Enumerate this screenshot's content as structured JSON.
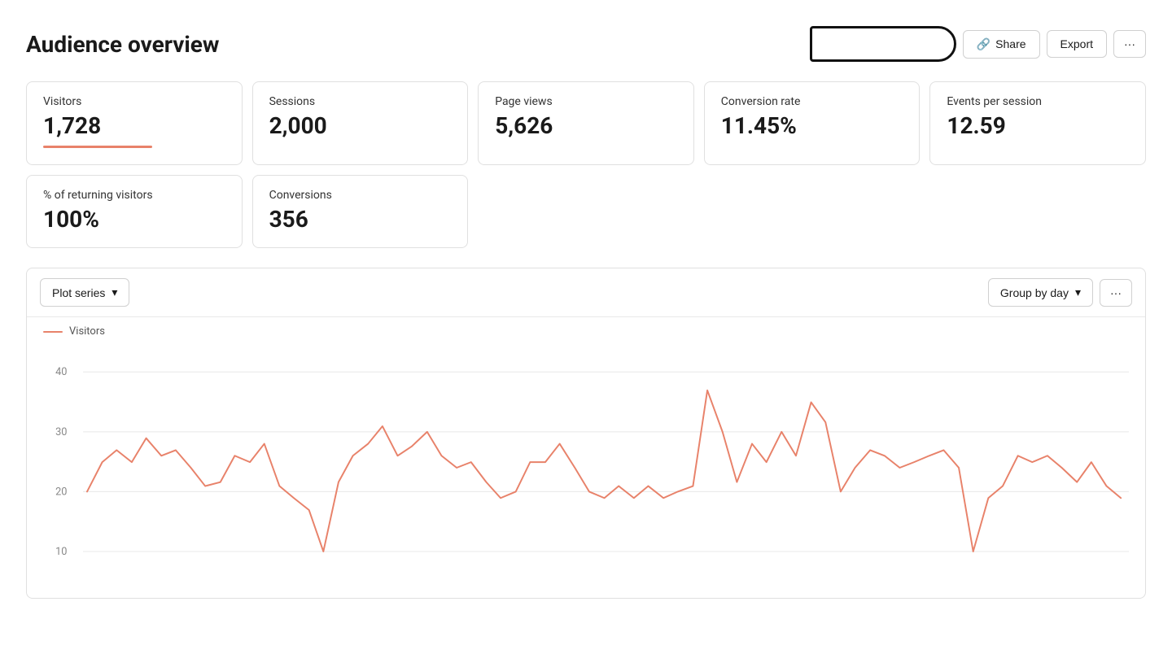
{
  "page": {
    "title": "Audience overview"
  },
  "header": {
    "share_label": "Share",
    "export_label": "Export",
    "more_label": "···"
  },
  "metrics_row1": [
    {
      "label": "Visitors",
      "value": "1,728",
      "underline": true
    },
    {
      "label": "Sessions",
      "value": "2,000",
      "underline": false
    },
    {
      "label": "Page views",
      "value": "5,626",
      "underline": false
    },
    {
      "label": "Conversion rate",
      "value": "11.45%",
      "underline": false
    },
    {
      "label": "Events per session",
      "value": "12.59",
      "underline": false
    }
  ],
  "metrics_row2": [
    {
      "label": "% of returning visitors",
      "value": "100%",
      "underline": false
    },
    {
      "label": "Conversions",
      "value": "356",
      "underline": false
    }
  ],
  "chart": {
    "plot_series_label": "Plot series",
    "group_by_label": "Group by day",
    "legend_label": "Visitors",
    "y_labels": [
      "40",
      "30",
      "20",
      "10"
    ],
    "accent_color": "#e8826a"
  }
}
